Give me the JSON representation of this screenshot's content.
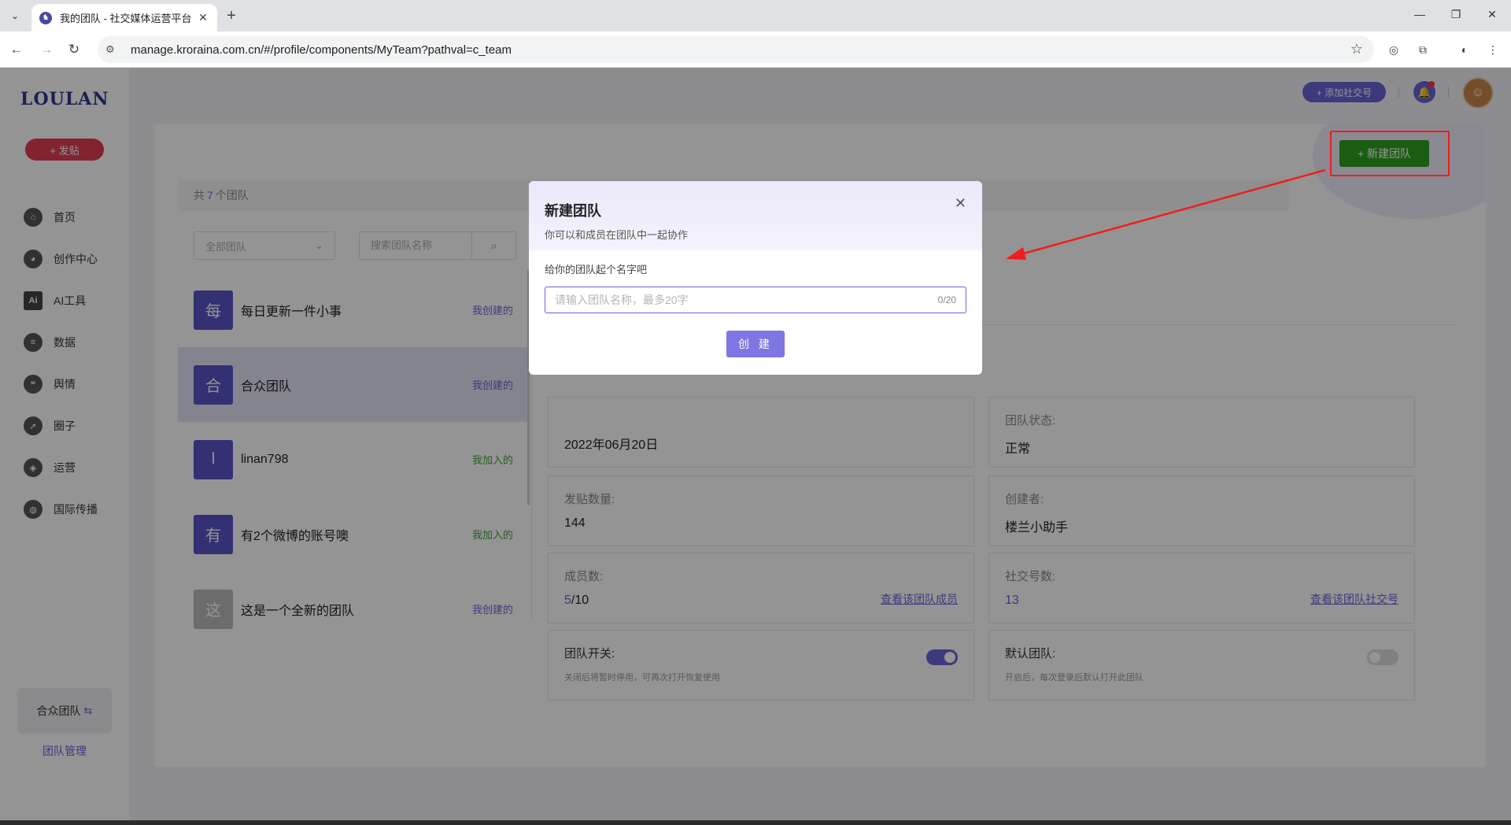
{
  "browser": {
    "tab_title": "我的团队 - 社交媒体运营平台",
    "url": "manage.kroraina.com.cn/#/profile/components/MyTeam?pathval=c_team"
  },
  "sidebar": {
    "logo": "LOULAN",
    "post_button": "+ 发贴",
    "items": [
      {
        "label": "首页",
        "icon": "home-icon"
      },
      {
        "label": "创作中心",
        "icon": "palette-icon"
      },
      {
        "label": "AI工具",
        "icon": "ai-icon"
      },
      {
        "label": "数据",
        "icon": "database-icon"
      },
      {
        "label": "舆情",
        "icon": "quote-icon"
      },
      {
        "label": "圈子",
        "icon": "compass-icon"
      },
      {
        "label": "运营",
        "icon": "shield-icon"
      },
      {
        "label": "国际传播",
        "icon": "globe-icon"
      }
    ],
    "current_team": "合众团队",
    "team_manage": "团队管理"
  },
  "header": {
    "add_social": "+ 添加社交号"
  },
  "page": {
    "new_team_button": "+ 新建团队",
    "count_prefix": "共",
    "count_value": "7",
    "count_suffix": "个团队",
    "filter_placeholder": "全部团队",
    "search_placeholder": "搜索团队名称",
    "teams": [
      {
        "avatar": "每",
        "name": "每日更新一件小事",
        "tag": "我创建的",
        "type": "mine"
      },
      {
        "avatar": "合",
        "name": "合众团队",
        "tag": "我创建的",
        "type": "mine"
      },
      {
        "avatar": "l",
        "name": "linan798",
        "tag": "我加入的",
        "type": "joined"
      },
      {
        "avatar": "有",
        "name": "有2个微博的账号噢",
        "tag": "我加入的",
        "type": "joined"
      },
      {
        "avatar": "这",
        "name": "这是一个全新的团队",
        "tag": "我创建的",
        "type": "mine"
      }
    ],
    "details": {
      "created_date": "2022年06月20日",
      "status_label": "团队状态:",
      "status_value": "正常",
      "posts_label": "发贴数量:",
      "posts_value": "144",
      "creator_label": "创建者:",
      "creator_value": "楼兰小助手",
      "members_label": "成员数:",
      "members_current": "5",
      "members_total": "/10",
      "members_link": "查看该团队成员",
      "social_label": "社交号数:",
      "social_value": "13",
      "social_link": "查看该团队社交号",
      "switch_label": "团队开关:",
      "switch_hint": "关闭后将暂时停用，可再次打开恢复使用",
      "switch_on": true,
      "default_label": "默认团队:",
      "default_hint": "开启后，每次登录后默认打开此团队",
      "default_on": false
    }
  },
  "modal": {
    "title": "新建团队",
    "subtitle": "你可以和成员在团队中一起协作",
    "prompt": "给你的团队起个名字吧",
    "input_placeholder": "请输入团队名称，最多20字",
    "input_value": "",
    "counter": "0/20",
    "create_button": "创 建"
  },
  "colors": {
    "accent": "#6a63d8",
    "success": "#2ea121",
    "danger": "#e23d52",
    "annotation_red": "#f01d1d"
  }
}
